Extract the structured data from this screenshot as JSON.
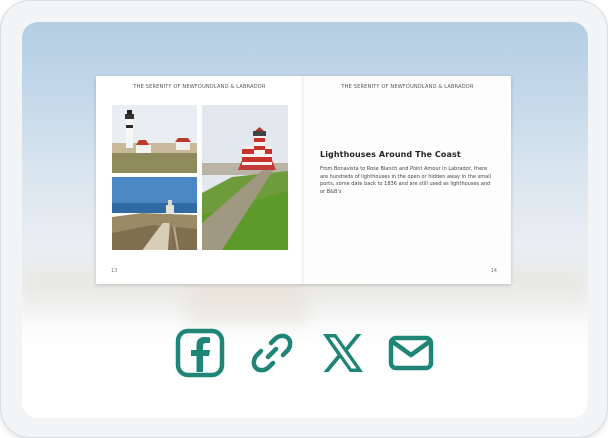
{
  "book": {
    "left_page": {
      "running_head": "THE SERENITY OF NEWFOUNDLAND & LABRADOR",
      "page_number": "13"
    },
    "right_page": {
      "running_head": "THE SERENITY OF NEWFOUNDLAND & LABRADOR",
      "page_number": "14",
      "title": "Lighthouses Around The Coast",
      "body": "From Bonavista to Rose Blanch and Point Amour in Labrador, there are hundreds of lighthouses in the open or hidden away in the small ports, some date back to 1836 and are still used as lighthouses and or B&B's"
    }
  },
  "share": {
    "items": [
      {
        "icon": "facebook-icon"
      },
      {
        "icon": "link-icon"
      },
      {
        "icon": "x-icon"
      },
      {
        "icon": "mail-icon"
      }
    ],
    "color": "#1e8577"
  }
}
